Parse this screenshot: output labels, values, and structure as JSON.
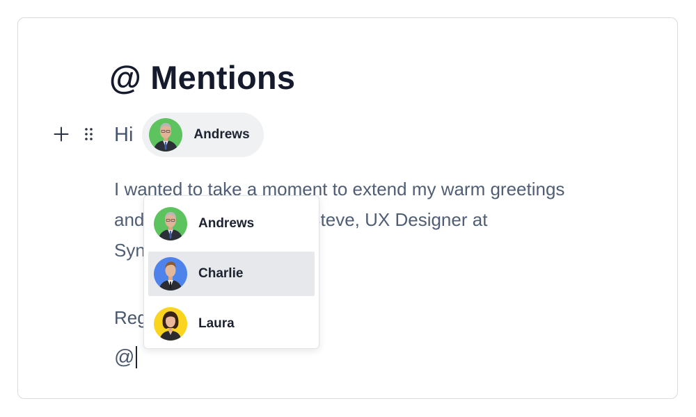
{
  "editor": {
    "title": "@ Mentions",
    "greeting": "Hi",
    "mention_chip": {
      "name": "Andrews",
      "avatar": "andrews-avatar"
    },
    "paragraph": {
      "line1": "I wanted to take a moment to extend my warm greetings",
      "line2_start": "and",
      "line2_end": "I am Steve, UX Designer at",
      "line3_start": "Syn"
    },
    "closing": "Reg",
    "trigger": "@",
    "icons": {
      "add_block": "plus-icon",
      "drag_handle": "drag-handle-icon"
    }
  },
  "mention_popup": {
    "selected_index": 1,
    "items": [
      {
        "name": "Andrews",
        "avatar_color": "#5cc35f"
      },
      {
        "name": "Charlie",
        "avatar_color": "#4d83ea"
      },
      {
        "name": "Laura",
        "avatar_color": "#fad41f"
      }
    ]
  },
  "colors": {
    "title": "#151a2d",
    "body_text": "#4f5e74",
    "chip_bg": "#f0f1f3",
    "selected_item_bg": "#e7e8ec"
  }
}
